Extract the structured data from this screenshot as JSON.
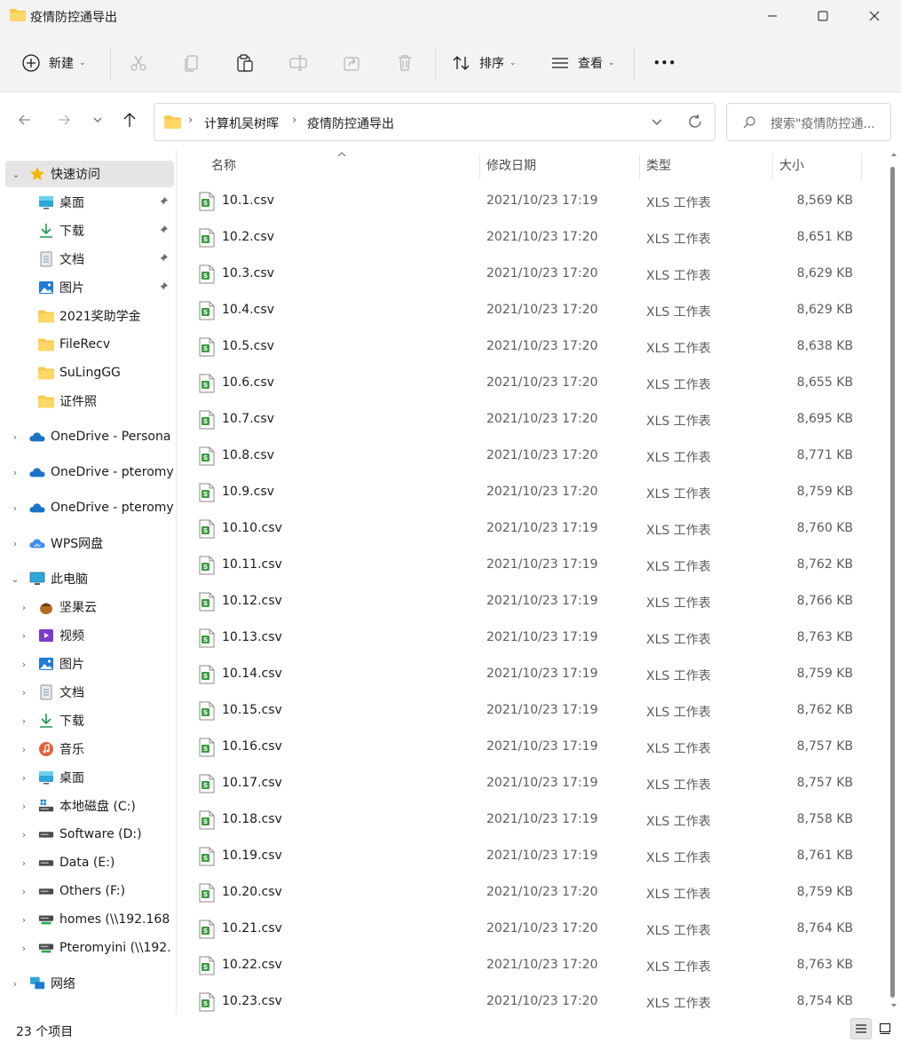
{
  "window": {
    "title": "疫情防控通导出",
    "minimize_glyph": "—",
    "maximize_glyph": "☐",
    "close_glyph": "✕"
  },
  "toolbar": {
    "new_label": "新建",
    "sort_label": "排序",
    "view_label": "查看",
    "more_glyph": "•••"
  },
  "address": {
    "path": [
      "计算机吴树晖",
      "疫情防控通导出"
    ],
    "search_placeholder": "搜索\"疫情防控通..."
  },
  "sidebar": {
    "items": [
      {
        "label": "快速访问",
        "icon": "star-icon",
        "pinned": false
      },
      {
        "label": "桌面",
        "icon": "desktop-icon",
        "pinned": true
      },
      {
        "label": "下载",
        "icon": "download-icon",
        "pinned": true
      },
      {
        "label": "文档",
        "icon": "document-icon",
        "pinned": true
      },
      {
        "label": "图片",
        "icon": "pictures-icon",
        "pinned": true
      },
      {
        "label": "2021奖助学金",
        "icon": "folder-icon",
        "pinned": false
      },
      {
        "label": "FileRecv",
        "icon": "folder-icon",
        "pinned": false
      },
      {
        "label": "SuLingGG",
        "icon": "folder-icon",
        "pinned": false
      },
      {
        "label": "证件照",
        "icon": "folder-icon",
        "pinned": false
      },
      {
        "label": "OneDrive - Persona",
        "icon": "onedrive-icon"
      },
      {
        "label": "OneDrive - pteromy",
        "icon": "onedrive-icon"
      },
      {
        "label": "OneDrive - pteromy",
        "icon": "onedrive-icon"
      },
      {
        "label": "WPS网盘",
        "icon": "wps-cloud-icon"
      },
      {
        "label": "此电脑",
        "icon": "this-pc-icon"
      },
      {
        "label": "坚果云",
        "icon": "nutstore-icon"
      },
      {
        "label": "视频",
        "icon": "videos-icon"
      },
      {
        "label": "图片",
        "icon": "pictures-icon"
      },
      {
        "label": "文档",
        "icon": "document-icon"
      },
      {
        "label": "下载",
        "icon": "download-icon"
      },
      {
        "label": "音乐",
        "icon": "music-icon"
      },
      {
        "label": "桌面",
        "icon": "desktop-icon"
      },
      {
        "label": "本地磁盘 (C:)",
        "icon": "drive-c-icon"
      },
      {
        "label": "Software (D:)",
        "icon": "drive-icon"
      },
      {
        "label": "Data (E:)",
        "icon": "drive-icon"
      },
      {
        "label": "Others (F:)",
        "icon": "drive-icon"
      },
      {
        "label": "homes (\\\\192.168",
        "icon": "network-drive-icon"
      },
      {
        "label": "Pteromyini (\\\\192.",
        "icon": "network-drive-icon"
      },
      {
        "label": "网络",
        "icon": "network-icon"
      }
    ]
  },
  "table": {
    "columns": [
      "名称",
      "修改日期",
      "类型",
      "大小"
    ],
    "rows": [
      {
        "name": "10.1.csv",
        "date": "2021/10/23 17:19",
        "type": "XLS 工作表",
        "size": "8,569 KB"
      },
      {
        "name": "10.2.csv",
        "date": "2021/10/23 17:20",
        "type": "XLS 工作表",
        "size": "8,651 KB"
      },
      {
        "name": "10.3.csv",
        "date": "2021/10/23 17:20",
        "type": "XLS 工作表",
        "size": "8,629 KB"
      },
      {
        "name": "10.4.csv",
        "date": "2021/10/23 17:20",
        "type": "XLS 工作表",
        "size": "8,629 KB"
      },
      {
        "name": "10.5.csv",
        "date": "2021/10/23 17:20",
        "type": "XLS 工作表",
        "size": "8,638 KB"
      },
      {
        "name": "10.6.csv",
        "date": "2021/10/23 17:20",
        "type": "XLS 工作表",
        "size": "8,655 KB"
      },
      {
        "name": "10.7.csv",
        "date": "2021/10/23 17:20",
        "type": "XLS 工作表",
        "size": "8,695 KB"
      },
      {
        "name": "10.8.csv",
        "date": "2021/10/23 17:20",
        "type": "XLS 工作表",
        "size": "8,771 KB"
      },
      {
        "name": "10.9.csv",
        "date": "2021/10/23 17:20",
        "type": "XLS 工作表",
        "size": "8,759 KB"
      },
      {
        "name": "10.10.csv",
        "date": "2021/10/23 17:19",
        "type": "XLS 工作表",
        "size": "8,760 KB"
      },
      {
        "name": "10.11.csv",
        "date": "2021/10/23 17:19",
        "type": "XLS 工作表",
        "size": "8,762 KB"
      },
      {
        "name": "10.12.csv",
        "date": "2021/10/23 17:19",
        "type": "XLS 工作表",
        "size": "8,766 KB"
      },
      {
        "name": "10.13.csv",
        "date": "2021/10/23 17:19",
        "type": "XLS 工作表",
        "size": "8,763 KB"
      },
      {
        "name": "10.14.csv",
        "date": "2021/10/23 17:19",
        "type": "XLS 工作表",
        "size": "8,759 KB"
      },
      {
        "name": "10.15.csv",
        "date": "2021/10/23 17:19",
        "type": "XLS 工作表",
        "size": "8,762 KB"
      },
      {
        "name": "10.16.csv",
        "date": "2021/10/23 17:19",
        "type": "XLS 工作表",
        "size": "8,757 KB"
      },
      {
        "name": "10.17.csv",
        "date": "2021/10/23 17:19",
        "type": "XLS 工作表",
        "size": "8,757 KB"
      },
      {
        "name": "10.18.csv",
        "date": "2021/10/23 17:19",
        "type": "XLS 工作表",
        "size": "8,758 KB"
      },
      {
        "name": "10.19.csv",
        "date": "2021/10/23 17:19",
        "type": "XLS 工作表",
        "size": "8,761 KB"
      },
      {
        "name": "10.20.csv",
        "date": "2021/10/23 17:20",
        "type": "XLS 工作表",
        "size": "8,759 KB"
      },
      {
        "name": "10.21.csv",
        "date": "2021/10/23 17:20",
        "type": "XLS 工作表",
        "size": "8,764 KB"
      },
      {
        "name": "10.22.csv",
        "date": "2021/10/23 17:20",
        "type": "XLS 工作表",
        "size": "8,763 KB"
      },
      {
        "name": "10.23.csv",
        "date": "2021/10/23 17:20",
        "type": "XLS 工作表",
        "size": "8,754 KB"
      }
    ]
  },
  "status": {
    "item_count": "23 个项目"
  },
  "colors": {
    "folder": "#f8c84a",
    "accent": "#0067c0",
    "csv_icon": "#3d9c3d"
  }
}
